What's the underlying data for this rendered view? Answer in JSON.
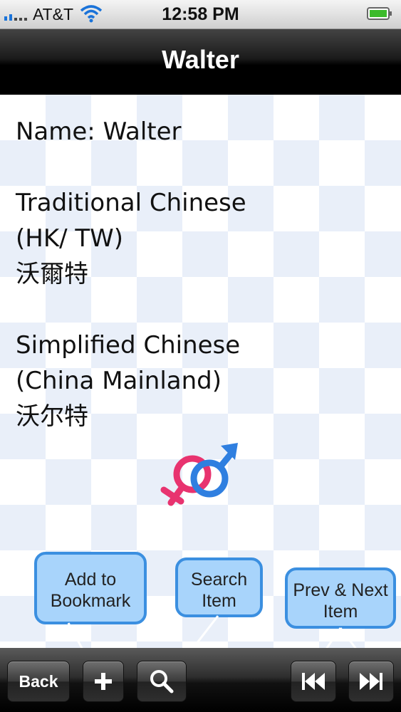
{
  "status_bar": {
    "carrier": "AT&T",
    "time": "12:58 PM"
  },
  "nav": {
    "title": "Walter"
  },
  "content": {
    "name_line": "Name: Walter",
    "traditional_label_1": "Traditional Chinese",
    "traditional_label_2": "(HK/ TW)",
    "traditional_value": "沃爾特",
    "simplified_label_1": "Simplified Chinese",
    "simplified_label_2": "(China Mainland)",
    "simplified_value": "沃尔特",
    "gender_icon": "male-female-symbol-icon"
  },
  "callouts": {
    "bookmark": [
      "Add to",
      "Bookmark"
    ],
    "search": [
      "Search",
      "Item"
    ],
    "prevnext": [
      "Prev & Next",
      "Item"
    ]
  },
  "toolbar": {
    "back_label": "Back",
    "add_icon": "plus-icon",
    "search_icon": "magnifier-icon",
    "prev_icon": "rewind-icon",
    "next_icon": "fast-forward-icon"
  },
  "colors": {
    "callout_fill": "#a8d4fb",
    "callout_border": "#3b8fe0",
    "female_symbol": "#e8336f",
    "male_symbol": "#2f7fe0"
  }
}
